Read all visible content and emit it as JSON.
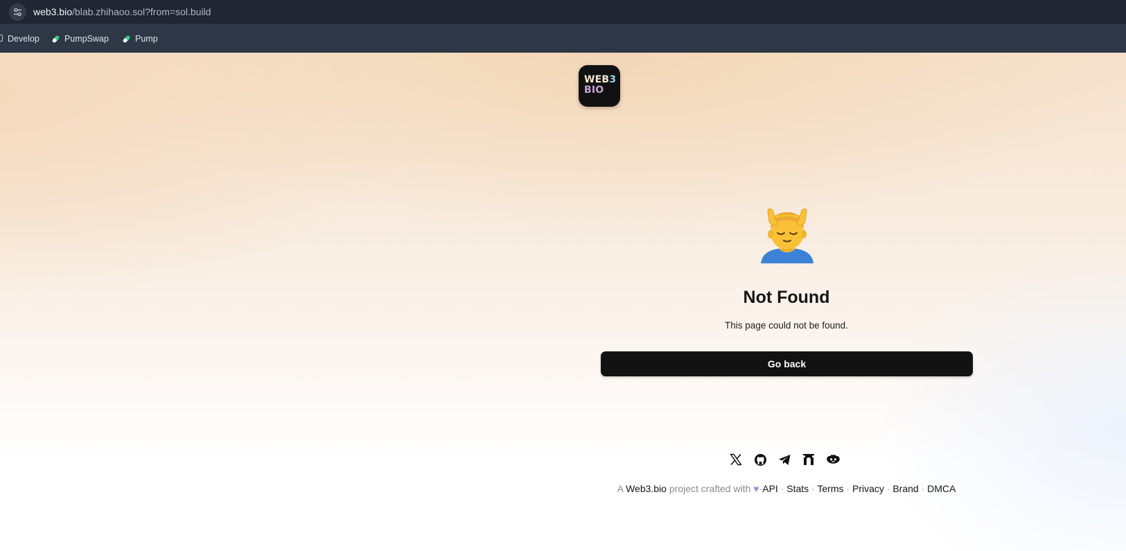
{
  "browser": {
    "url_domain": "web3.bio",
    "url_rest": "/blab.zhihaoo.sol?from=sol.build",
    "site_settings_icon": "tune-icon"
  },
  "bookmarks": {
    "items": [
      {
        "label": "Develop",
        "icon": "folder-icon"
      },
      {
        "label": "PumpSwap",
        "icon": "pill-icon",
        "icon_color": "#2fd087"
      },
      {
        "label": "Pump",
        "icon": "pill-icon",
        "icon_color": "#2fd087"
      }
    ]
  },
  "logo": {
    "line1_a": "WEB",
    "line1_b": "3",
    "line2": "BIO",
    "colors": {
      "web": "#f3e6cf",
      "three": "#8fd3ef",
      "bio": "#c9a0d6"
    }
  },
  "main": {
    "emoji_icon": "person-getting-massage-emoji",
    "title": "Not Found",
    "message": "This page could not be found.",
    "go_back": "Go back"
  },
  "socials": [
    {
      "name": "x-icon"
    },
    {
      "name": "github-icon"
    },
    {
      "name": "telegram-icon"
    },
    {
      "name": "gateway-icon"
    },
    {
      "name": "lens-icon"
    }
  ],
  "footer": {
    "prefix": "A",
    "brand": "Web3.bio",
    "crafted": "project crafted with",
    "heart": "♥",
    "sep": "·",
    "links": [
      "API",
      "Stats",
      "Terms",
      "Privacy",
      "Brand",
      "DMCA"
    ]
  },
  "colors": {
    "chrome_top": "#202733",
    "chrome_bookmarks": "#2e3746",
    "button_bg": "#121212",
    "peach": "#f4d9ba"
  }
}
